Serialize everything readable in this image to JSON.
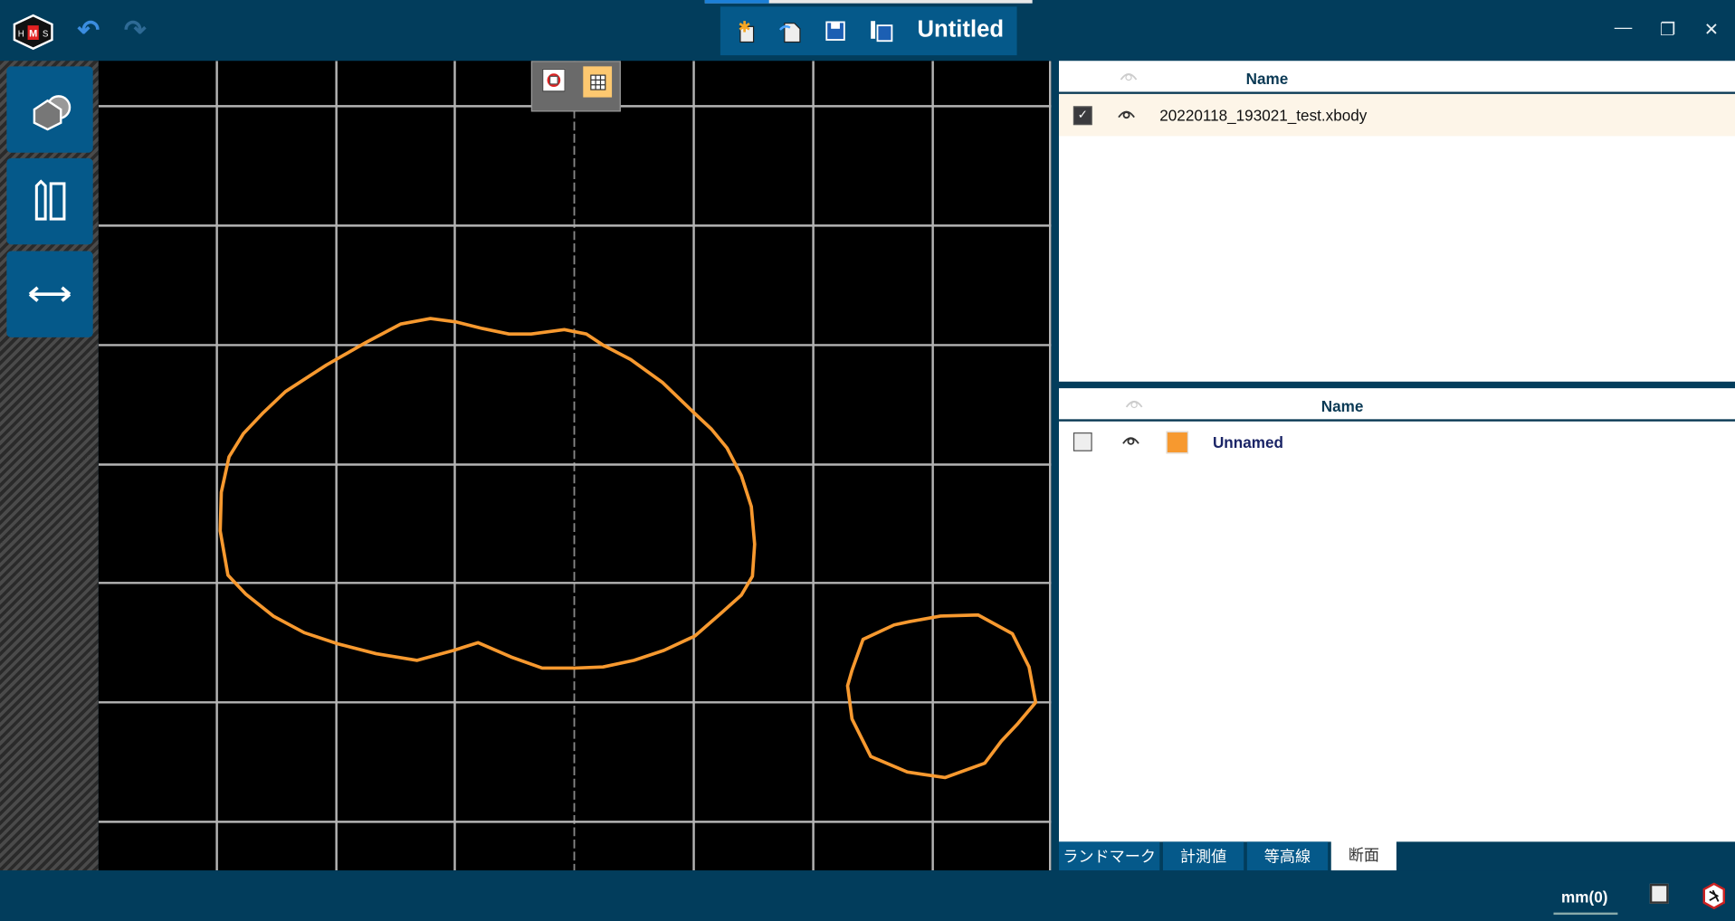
{
  "app": {
    "logo": "HMS",
    "title": "Untitled"
  },
  "toolbar": {
    "icons": [
      "undo-icon",
      "redo-icon",
      "new-file-icon",
      "open-file-icon",
      "save-icon",
      "save-as-icon"
    ]
  },
  "window_controls": {
    "minimize": "—",
    "restore": "❐",
    "close": "✕"
  },
  "left_tools": [
    "shape-tool-icon",
    "measure-tool-icon",
    "dimension-tool-icon"
  ],
  "view_toggles": [
    "fit-view-icon",
    "grid-toggle-icon"
  ],
  "body_list": {
    "header": "Name",
    "rows": [
      {
        "checked": true,
        "visible": true,
        "name": "20220118_193021_test.xbody"
      }
    ]
  },
  "section_list": {
    "header": "Name",
    "rows": [
      {
        "checked": false,
        "visible": true,
        "color": "#f7992f",
        "name": "Unnamed"
      }
    ]
  },
  "tabs": [
    {
      "label": "ランドマーク",
      "active": false
    },
    {
      "label": "計測値",
      "active": false
    },
    {
      "label": "等高線",
      "active": false
    },
    {
      "label": "断面",
      "active": true
    }
  ],
  "status": {
    "unit": "mm(0)"
  },
  "colors": {
    "accent": "#05598a",
    "frame": "#023d5c",
    "curve": "#f7992f",
    "selected_row": "#fdf5e8"
  }
}
